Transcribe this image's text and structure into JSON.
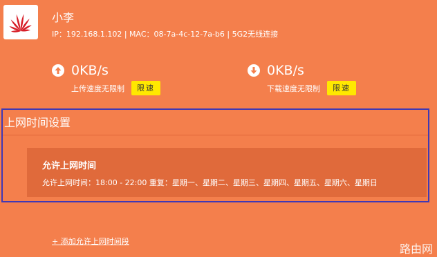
{
  "device": {
    "name": "小李",
    "info": "IP：192.168.1.102 | MAC：08-7a-4c-12-7a-b6 | 5G2无线连接"
  },
  "upload": {
    "value": "0KB/s",
    "label": "上传速度无限制",
    "button": "限速"
  },
  "download": {
    "value": "0KB/s",
    "label": "下载速度无限制",
    "button": "限速"
  },
  "time_settings": {
    "title": "上网时间设置",
    "rule": {
      "title": "允许上网时间",
      "detail": "允许上网时间：18:00 - 22:00   重复：星期一、星期二、星期三、星期四、星期五、星期六、星期日"
    },
    "add_link": "+ 添加允许上网时间段"
  },
  "watermark": "路由网",
  "icons": {
    "logo": "huawei-logo",
    "upload": "arrow-up-circle-icon",
    "download": "arrow-down-circle-icon"
  },
  "colors": {
    "background": "#f47f4c",
    "card": "#e06a3b",
    "button": "#ffe800",
    "highlight_border": "#3f38b5"
  }
}
